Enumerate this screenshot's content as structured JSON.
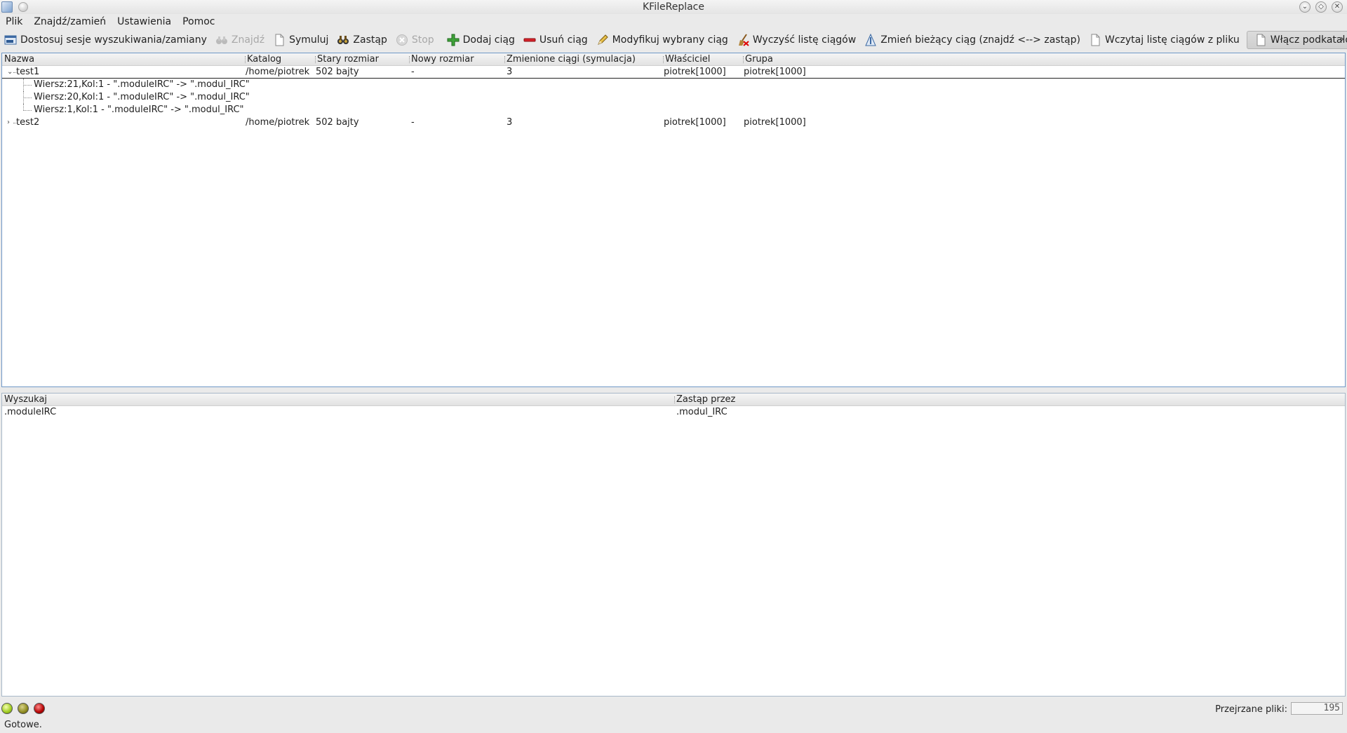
{
  "window": {
    "title": "KFileReplace"
  },
  "menubar": [
    "Plik",
    "Znajdź/zamień",
    "Ustawienia",
    "Pomoc"
  ],
  "toolbar": {
    "customize": "Dostosuj sesje wyszukiwania/zamiany",
    "find": "Znajdź",
    "simulate": "Symuluj",
    "replace": "Zastąp",
    "stop": "Stop",
    "add_string": "Dodaj ciąg",
    "remove_string": "Usuń ciąg",
    "edit_string": "Modyfikuj wybrany ciąg",
    "clear_list": "Wyczyść listę ciągów",
    "invert": "Zmień bieżący ciąg (znajdź <--> zastąp)",
    "load_list": "Wczytaj listę ciągów z pliku",
    "subfolders": "Włącz podkatalogi"
  },
  "results": {
    "columns": [
      "Nazwa",
      "Katalog",
      "Stary rozmiar",
      "Nowy rozmiar",
      "Zmienione ciągi (symulacja)",
      "Właściciel",
      "Grupa"
    ],
    "rows": [
      {
        "name": "test1",
        "folder": "/home/piotrek",
        "old_size": "502 bajty",
        "new_size": "-",
        "changed": "3",
        "owner": "piotrek[1000]",
        "group": "piotrek[1000]",
        "expanded": true,
        "children": [
          "Wiersz:21,Kol:1 - \".moduleIRC\" -> \".modul_IRC\"",
          "Wiersz:20,Kol:1 - \".moduleIRC\" -> \".modul_IRC\"",
          "Wiersz:1,Kol:1 - \".moduleIRC\" -> \".modul_IRC\""
        ]
      },
      {
        "name": "test2",
        "folder": "/home/piotrek",
        "old_size": "502 bajty",
        "new_size": "-",
        "changed": "3",
        "owner": "piotrek[1000]",
        "group": "piotrek[1000]",
        "expanded": false,
        "children": []
      }
    ]
  },
  "strings": {
    "columns": [
      "Wyszukaj",
      "Zastąp przez"
    ],
    "rows": [
      {
        "search": ".moduleIRC",
        "replace": ".modul_IRC"
      }
    ]
  },
  "statusbar": {
    "scanned_label": "Przejrzane pliki:",
    "scanned_value": "195",
    "message": "Gotowe."
  }
}
